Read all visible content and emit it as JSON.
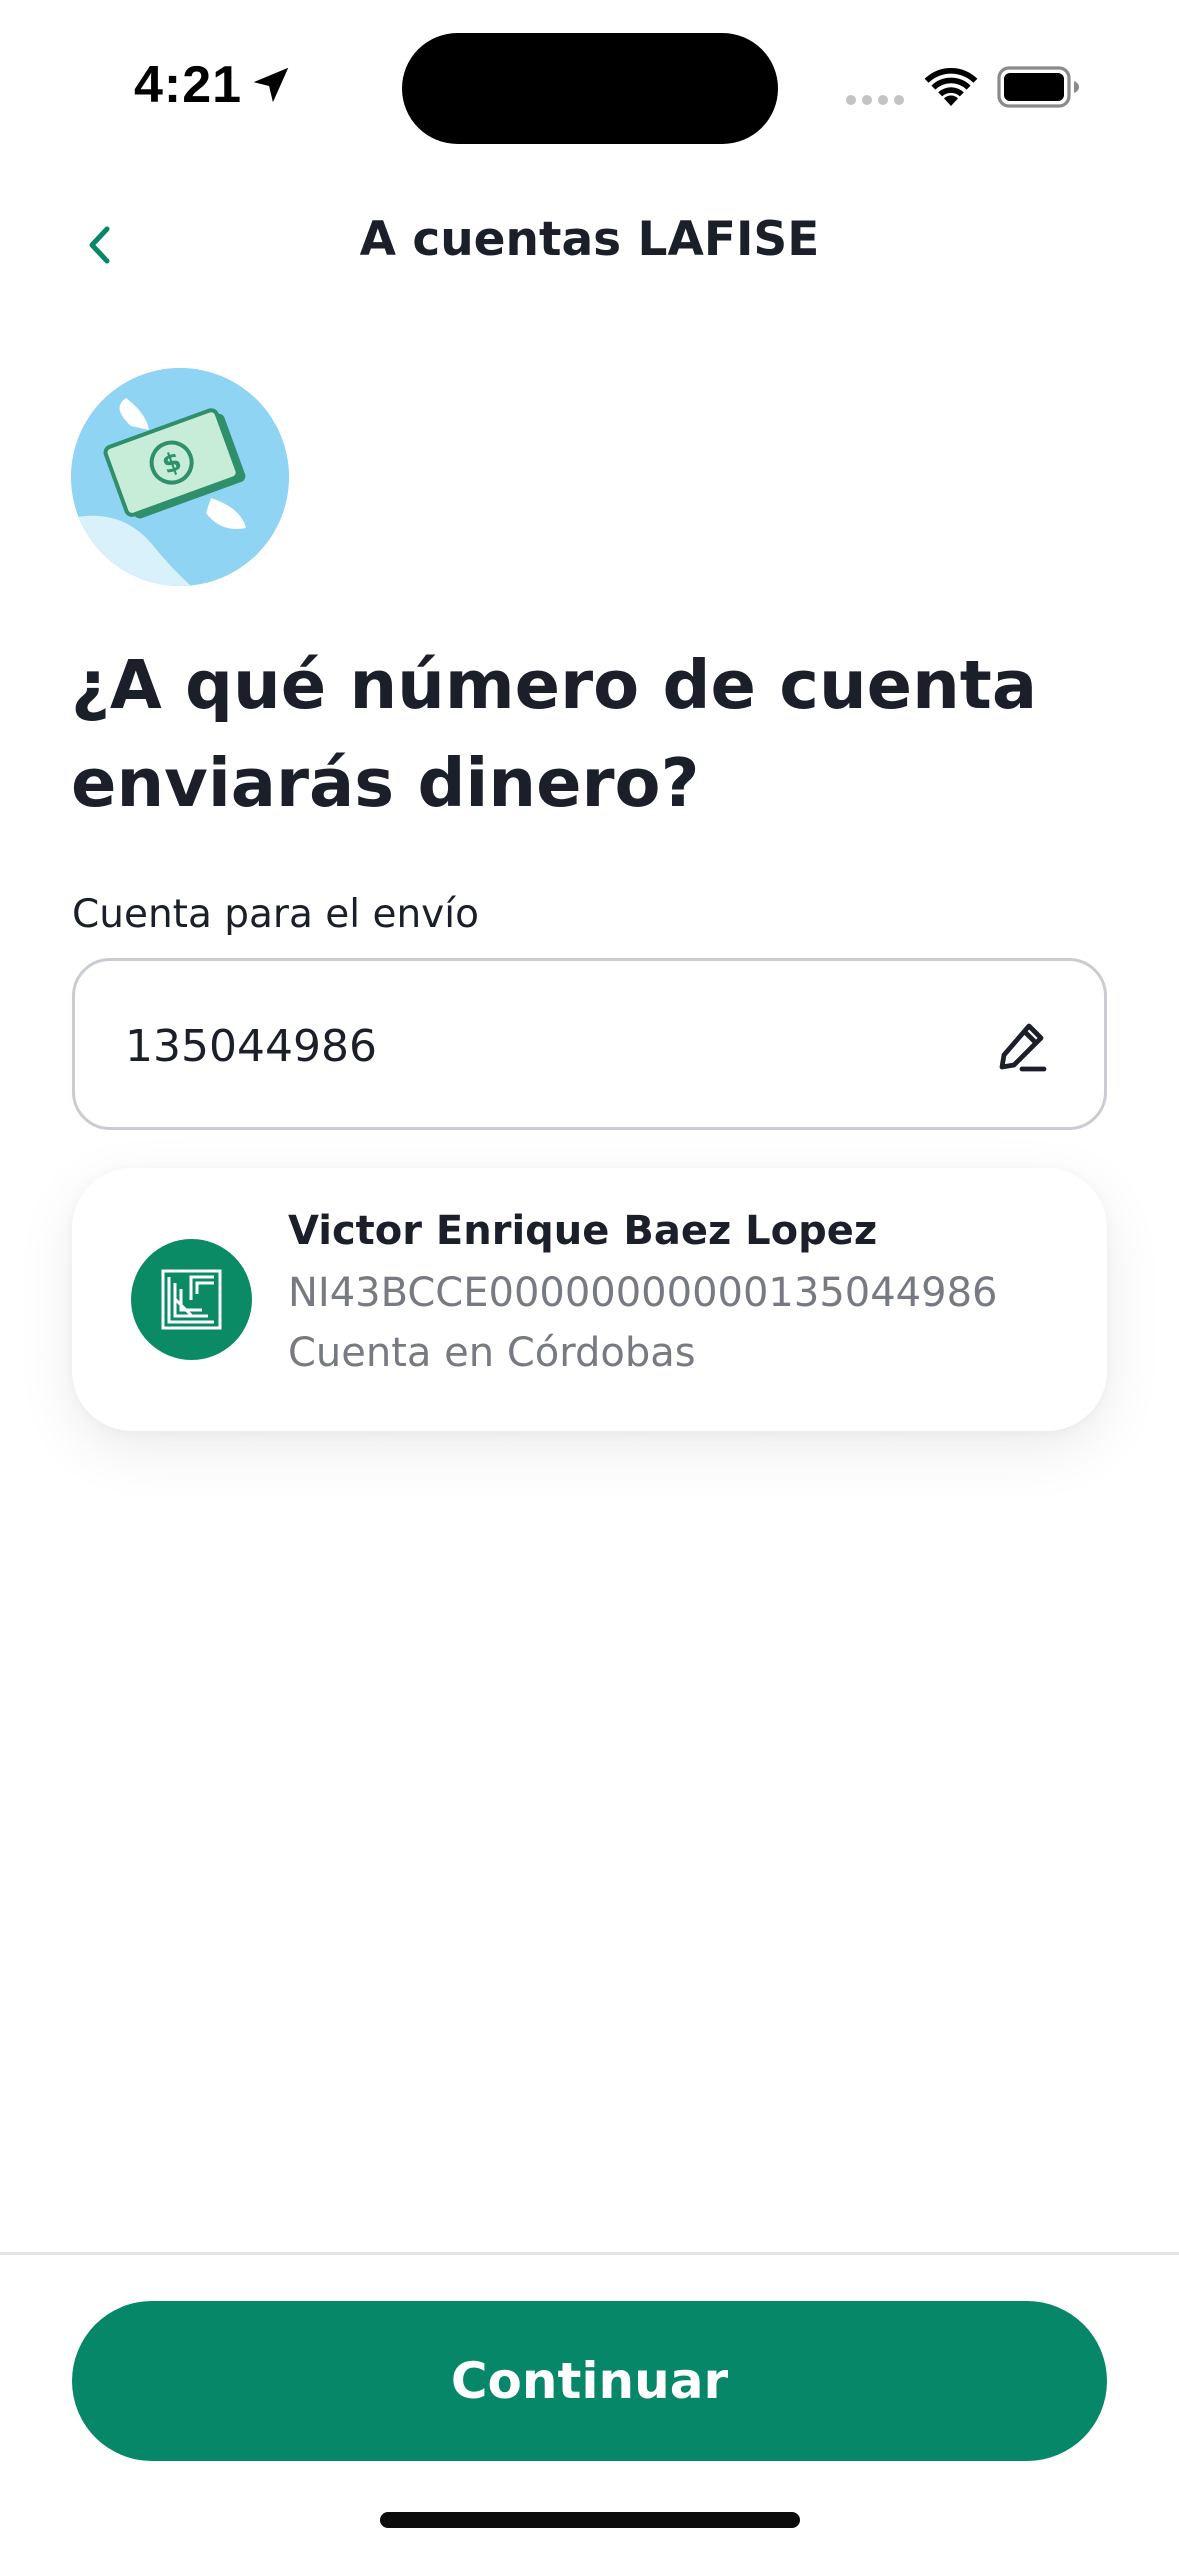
{
  "status_bar": {
    "time": "4:21",
    "icons": [
      "location-arrow-icon",
      "signal-icon",
      "wifi-icon",
      "battery-icon"
    ]
  },
  "header": {
    "title": "A cuentas LAFISE",
    "back_icon": "chevron-left-icon"
  },
  "illustration": {
    "icon": "flying-money-icon"
  },
  "question": {
    "line1": "¿A qué número de cuenta",
    "line2": "enviarás dinero?"
  },
  "account_field": {
    "label": "Cuenta para el envío",
    "value": "135044986",
    "edit_icon": "pencil-icon"
  },
  "result": {
    "name": "Victor Enrique Baez Lopez",
    "iban": "NI43BCCE00000000000135044986",
    "currency": "Cuenta en Córdobas",
    "logo_icon": "lafise-logo-icon"
  },
  "footer": {
    "continue_label": "Continuar"
  },
  "colors": {
    "accent": "#068767",
    "text": "#1b1f2a",
    "muted": "#777a83",
    "border": "#c9ccd3"
  }
}
